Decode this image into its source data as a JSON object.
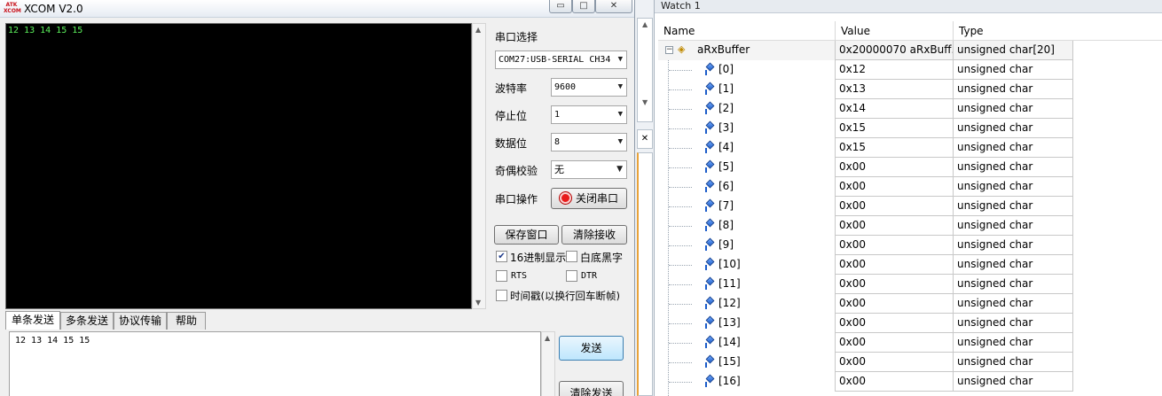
{
  "xcom": {
    "title": "XCOM V2.0",
    "logo_lines": [
      "ATK",
      "XCOM"
    ],
    "window_buttons": {
      "minimize": "▭",
      "maximize": "□",
      "close": "✕"
    },
    "receive_text": "12 13 14 15 15",
    "port_select_label": "串口选择",
    "port_value": "COM27:USB-SERIAL CH34",
    "baud_label": "波特率",
    "baud_value": "9600",
    "stopbits_label": "停止位",
    "stopbits_value": "1",
    "databits_label": "数据位",
    "databits_value": "8",
    "parity_label": "奇偶校验",
    "parity_value": "无",
    "port_op_label": "串口操作",
    "close_port_button": "关闭串口",
    "save_window_button": "保存窗口",
    "clear_receive_button": "清除接收",
    "hex_display_label": "16进制显示",
    "hex_display_checked": true,
    "white_bg_label": "白底黑字",
    "rts_label": "RTS",
    "dtr_label": "DTR",
    "timestamp_label": "时间戳(以换行回车断帧)",
    "tabs": [
      "单条发送",
      "多条发送",
      "协议传输",
      "帮助"
    ],
    "send_text": "12 13 14 15 15",
    "send_button": "发送",
    "clear_send_button": "清除发送"
  },
  "watch": {
    "title": "Watch 1",
    "columns": {
      "name": "Name",
      "value": "Value",
      "type": "Type"
    },
    "root": {
      "name": "aRxBuffer",
      "value": "0x20000070 aRxBuff...",
      "type": "unsigned char[20]"
    },
    "items": [
      {
        "name": "[0]",
        "value": "0x12",
        "type": "unsigned char"
      },
      {
        "name": "[1]",
        "value": "0x13",
        "type": "unsigned char"
      },
      {
        "name": "[2]",
        "value": "0x14",
        "type": "unsigned char"
      },
      {
        "name": "[3]",
        "value": "0x15",
        "type": "unsigned char"
      },
      {
        "name": "[4]",
        "value": "0x15",
        "type": "unsigned char"
      },
      {
        "name": "[5]",
        "value": "0x00",
        "type": "unsigned char"
      },
      {
        "name": "[6]",
        "value": "0x00",
        "type": "unsigned char"
      },
      {
        "name": "[7]",
        "value": "0x00",
        "type": "unsigned char"
      },
      {
        "name": "[8]",
        "value": "0x00",
        "type": "unsigned char"
      },
      {
        "name": "[9]",
        "value": "0x00",
        "type": "unsigned char"
      },
      {
        "name": "[10]",
        "value": "0x00",
        "type": "unsigned char"
      },
      {
        "name": "[11]",
        "value": "0x00",
        "type": "unsigned char"
      },
      {
        "name": "[12]",
        "value": "0x00",
        "type": "unsigned char"
      },
      {
        "name": "[13]",
        "value": "0x00",
        "type": "unsigned char"
      },
      {
        "name": "[14]",
        "value": "0x00",
        "type": "unsigned char"
      },
      {
        "name": "[15]",
        "value": "0x00",
        "type": "unsigned char"
      },
      {
        "name": "[16]",
        "value": "0x00",
        "type": "unsigned char"
      }
    ]
  },
  "icons": {
    "expand": "minus-box-icon",
    "struct": "struct-variable-icon",
    "element": "watch-element-diamond-icon"
  },
  "colors": {
    "receive_bg": "#000000",
    "receive_text": "#5cf25c",
    "element_icon": "#1b5cc9",
    "close_port_indicator": "#e81b1b"
  }
}
